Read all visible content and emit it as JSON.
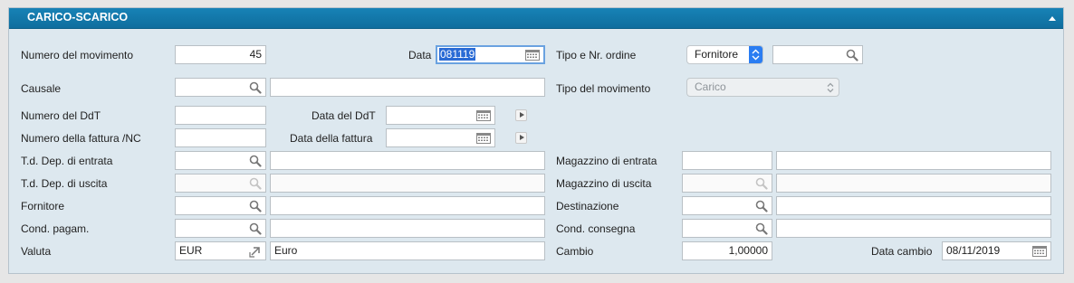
{
  "header": {
    "title": "CARICO-SCARICO"
  },
  "fields": {
    "numero_movimento": {
      "label": "Numero del movimento",
      "value": "45"
    },
    "data": {
      "label": "Data",
      "value": "081119"
    },
    "tipo_ordine": {
      "label": "Tipo e Nr. ordine",
      "select": "Fornitore",
      "value": ""
    },
    "causale": {
      "label": "Causale",
      "code": "",
      "desc": ""
    },
    "tipo_movimento": {
      "label": "Tipo del movimento",
      "select": "Carico"
    },
    "numero_ddt": {
      "label": "Numero del DdT",
      "value": ""
    },
    "data_ddt": {
      "label": "Data del DdT",
      "value": ""
    },
    "numero_fattura": {
      "label": "Numero della fattura /NC",
      "value": ""
    },
    "data_fattura": {
      "label": "Data della fattura",
      "value": ""
    },
    "td_entrata": {
      "label": "T.d. Dep. di entrata",
      "code": "",
      "desc": ""
    },
    "magazzino_entrata": {
      "label": "Magazzino di entrata",
      "code": "",
      "desc": ""
    },
    "td_uscita": {
      "label": "T.d. Dep. di uscita",
      "code": "",
      "desc": ""
    },
    "magazzino_uscita": {
      "label": "Magazzino di uscita",
      "code": "",
      "desc": ""
    },
    "fornitore": {
      "label": "Fornitore",
      "code": "",
      "desc": ""
    },
    "destinazione": {
      "label": "Destinazione",
      "code": "",
      "desc": ""
    },
    "cond_pagam": {
      "label": "Cond. pagam.",
      "code": "",
      "desc": ""
    },
    "cond_consegna": {
      "label": "Cond. consegna",
      "code": "",
      "desc": ""
    },
    "valuta": {
      "label": "Valuta",
      "code": "EUR",
      "desc": "Euro"
    },
    "cambio": {
      "label": "Cambio",
      "value": "1,00000"
    },
    "data_cambio": {
      "label": "Data cambio",
      "value": "08/11/2019"
    }
  },
  "colors": {
    "header": "#1279ab",
    "panel": "#dde8ef",
    "accent": "#2a7df2"
  }
}
